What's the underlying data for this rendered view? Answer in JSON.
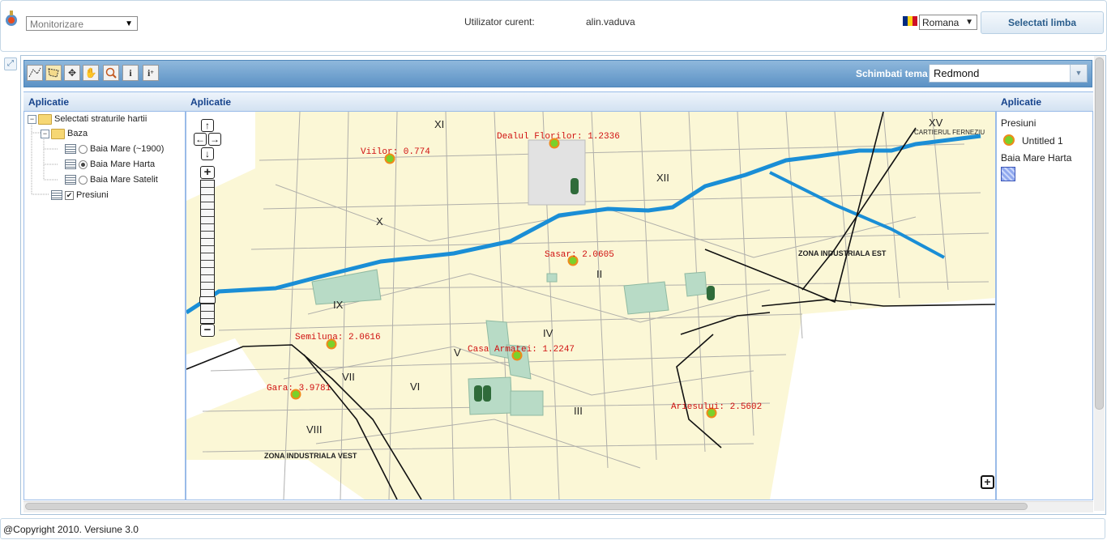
{
  "header": {
    "mode_select": {
      "value": "Monitorizare"
    },
    "user_label": "Utilizator curent:",
    "user_value": "alin.vaduva",
    "language_select": {
      "value": "Romana"
    },
    "language_button": "Selectati limba"
  },
  "toolbar": {
    "tools": [
      "draw-line-icon",
      "draw-polygon-icon",
      "pan-arrows-icon",
      "hand-icon",
      "zoom-box-icon",
      "info-icon",
      "info-plus-icon"
    ],
    "theme_label": "Schimbati tema",
    "theme_select": {
      "value": "Redmond"
    }
  },
  "panels": {
    "left_title": "Aplicatie",
    "center_title": "Aplicatie",
    "right_title": "Aplicatie"
  },
  "tree": {
    "root": "Selectati straturile hartii",
    "group": "Baza",
    "layers": [
      {
        "label": "Baia Mare (~1900)",
        "selected": false
      },
      {
        "label": "Baia Mare Harta",
        "selected": true
      },
      {
        "label": "Baia Mare Satelit",
        "selected": false
      }
    ],
    "overlay": {
      "label": "Presiuni",
      "checked": true
    }
  },
  "map": {
    "districts": [
      "XI",
      "XV",
      "XII",
      "X",
      "IX",
      "II",
      "IV",
      "V",
      "VII",
      "VI",
      "III",
      "VIII"
    ],
    "zones": [
      "ZONA INDUSTRIALA EST",
      "ZONA INDUSTRIALA VEST"
    ],
    "street_label": "CARTIERUL FERNEZIU",
    "sensors": [
      {
        "name": "Viilor",
        "value": "0.774",
        "label": "Viilor: 0.774"
      },
      {
        "name": "Dealul Florilor",
        "value": "1.2336",
        "label": "Dealul Florilor: 1.2336"
      },
      {
        "name": "Sasar",
        "value": "2.0605",
        "label": "Sasar: 2.0605"
      },
      {
        "name": "Semiluna",
        "value": "2.0616",
        "label": "Semiluna: 2.0616"
      },
      {
        "name": "Casa Armatei",
        "value": "1.2247",
        "label": "Casa Armatei: 1.2247"
      },
      {
        "name": "Gara",
        "value": "3.9781",
        "label": "Gara: 3.9781"
      },
      {
        "name": "Ariesului",
        "value": "2.5602",
        "label": "Ariesului: 2.5602"
      }
    ]
  },
  "legend": {
    "group1": "Presiuni",
    "item1": "Untitled 1",
    "group2": "Baia Mare Harta"
  },
  "footer": "@Copyright 2010. Versiune 3.0",
  "colors": {
    "river": "#1a8ed6",
    "map_bg": "#fbf7d6",
    "sensor_fill": "#7ad12a",
    "sensor_stroke": "#f08a1a",
    "label_red": "#d01010",
    "panel_title": "#15428b"
  }
}
